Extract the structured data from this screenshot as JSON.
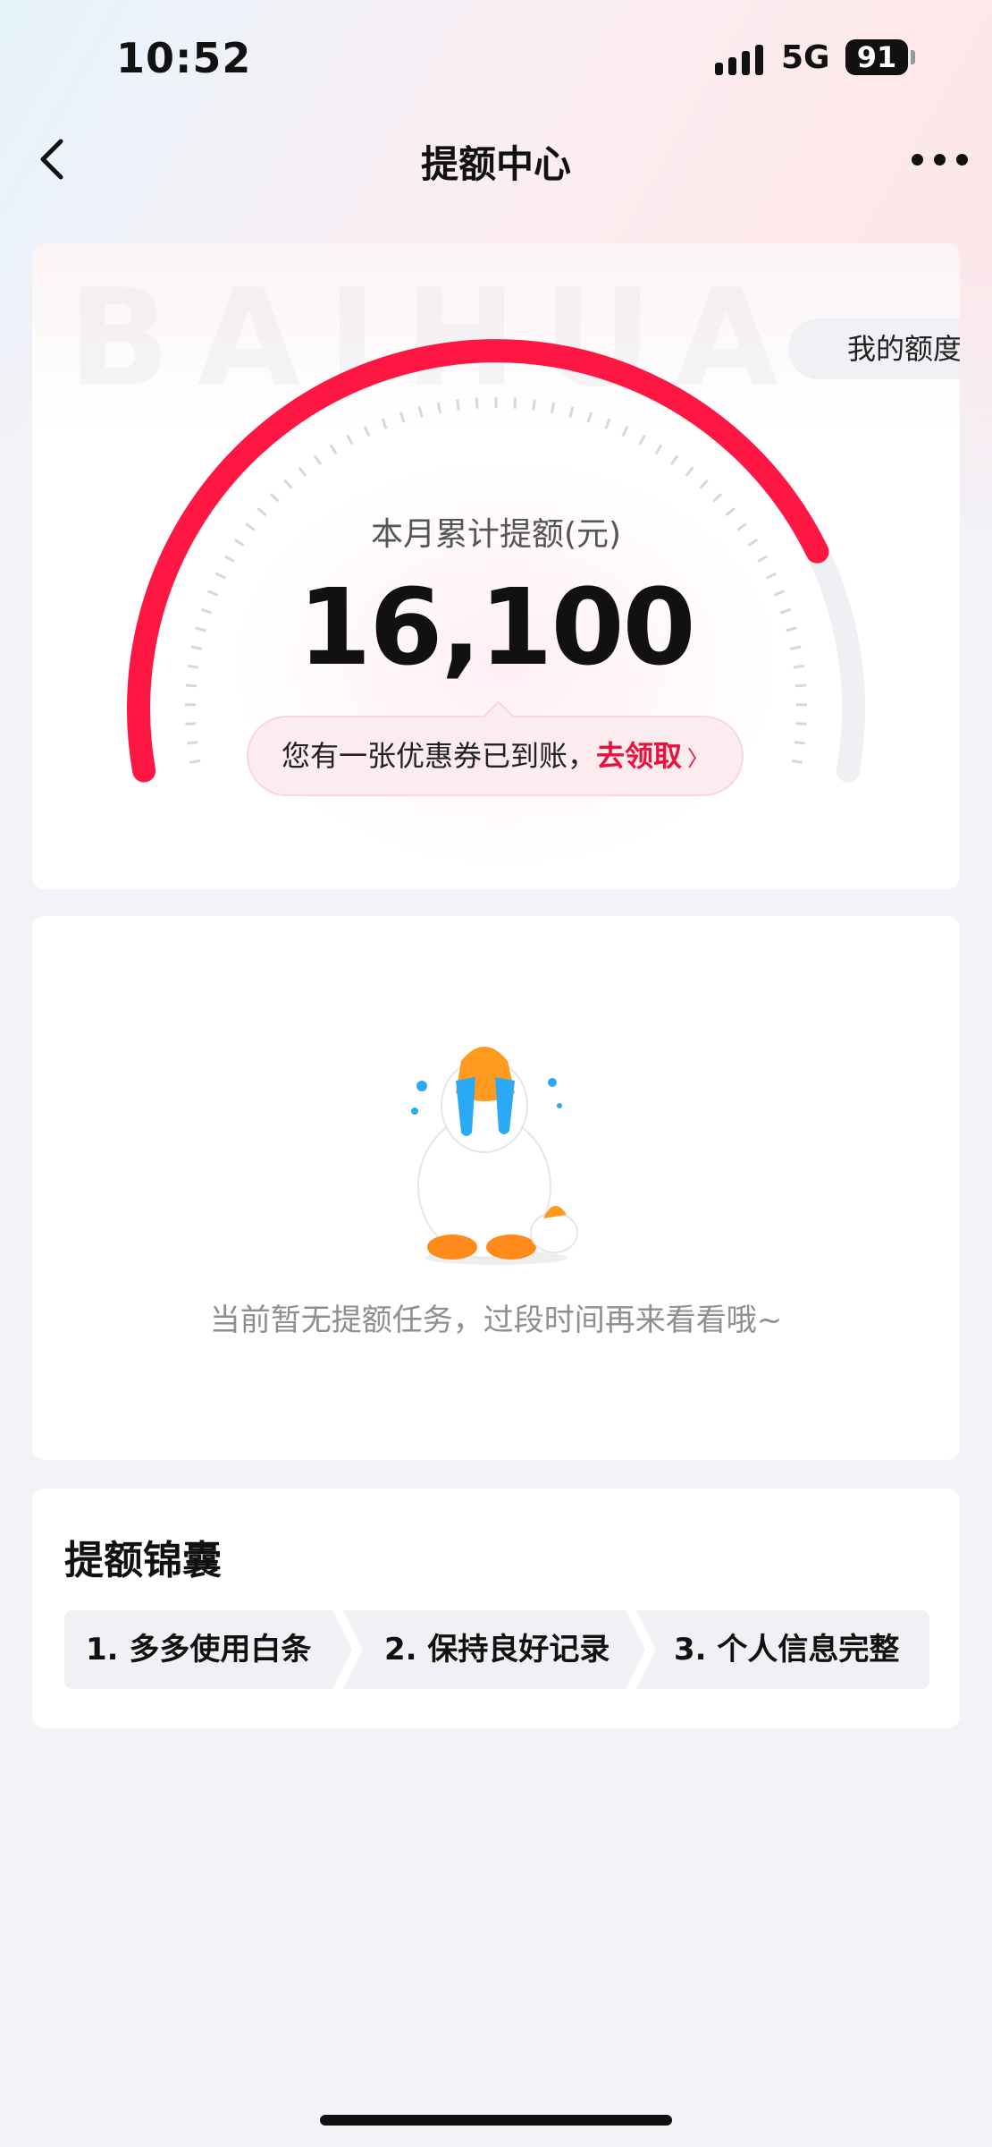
{
  "status_bar": {
    "time": "10:52",
    "network": "5G",
    "battery": "91"
  },
  "nav": {
    "title": "提额中心"
  },
  "quota_card": {
    "watermark": "BAIHUA",
    "my_quota_label": "我的额度",
    "gauge_label": "本月累计提额(元)",
    "gauge_value": "16,100",
    "gauge_fill_fraction": 0.82,
    "coupon_text": "您有一张优惠券已到账，",
    "coupon_link": "去领取",
    "colors": {
      "accent": "#ff1744",
      "track": "#f0eff4"
    }
  },
  "task_card": {
    "empty_text": "当前暂无提额任务，过段时间再来看看哦~",
    "illustration": "crying-duck-mascot"
  },
  "tips_card": {
    "title": "提额锦囊",
    "tips": [
      "1. 多多使用白条",
      "2. 保持良好记录",
      "3. 个人信息完整"
    ]
  }
}
